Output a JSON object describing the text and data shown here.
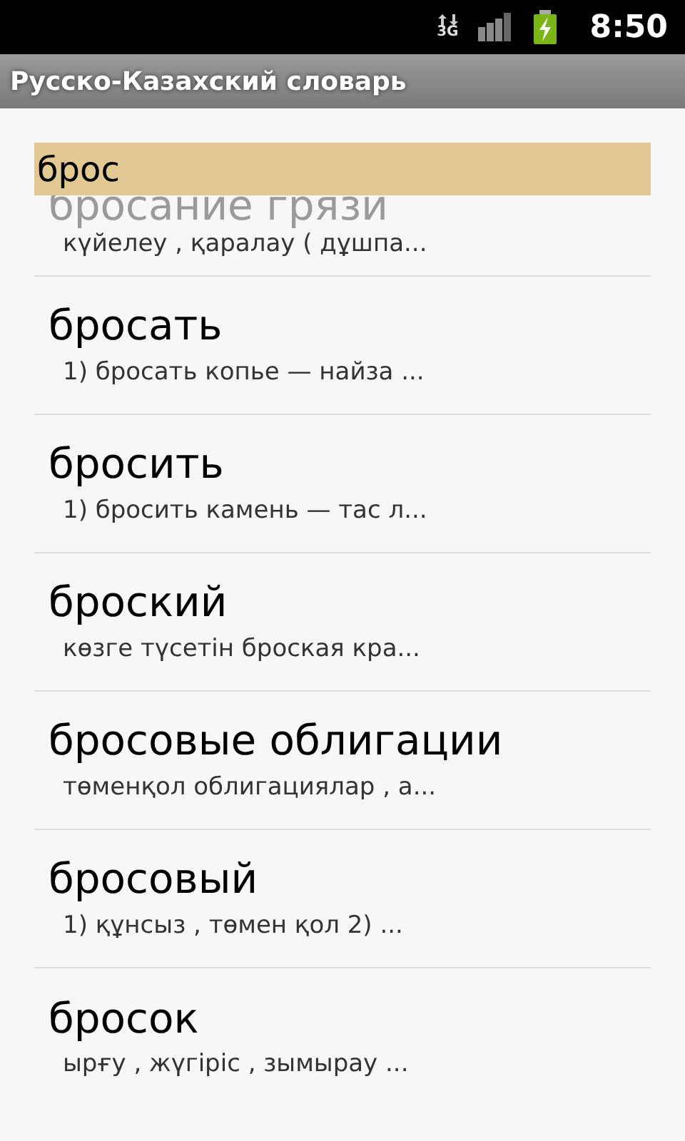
{
  "status_bar": {
    "network_type": "3G",
    "time": "8:50"
  },
  "title_bar": {
    "title": "Русско-Казахский словарь"
  },
  "search": {
    "value": "брос"
  },
  "entries": [
    {
      "headword": "бросание грязи",
      "translation": "күйелеу , қаралау ( дұшпа..."
    },
    {
      "headword": "бросать",
      "translation": "1) бросать копье — найза ..."
    },
    {
      "headword": "бросить",
      "translation": "1) бросить камень — тас л..."
    },
    {
      "headword": "броский",
      "translation": "көзге түсетін броская кра..."
    },
    {
      "headword": "бросовые облигации",
      "translation": "төменқол облигациялар , а..."
    },
    {
      "headword": "бросовый",
      "translation": "1) құнсыз , төмен қол 2) ..."
    },
    {
      "headword": "бросок",
      "translation": "ырғу , жүгіріс , зымырау ..."
    }
  ]
}
